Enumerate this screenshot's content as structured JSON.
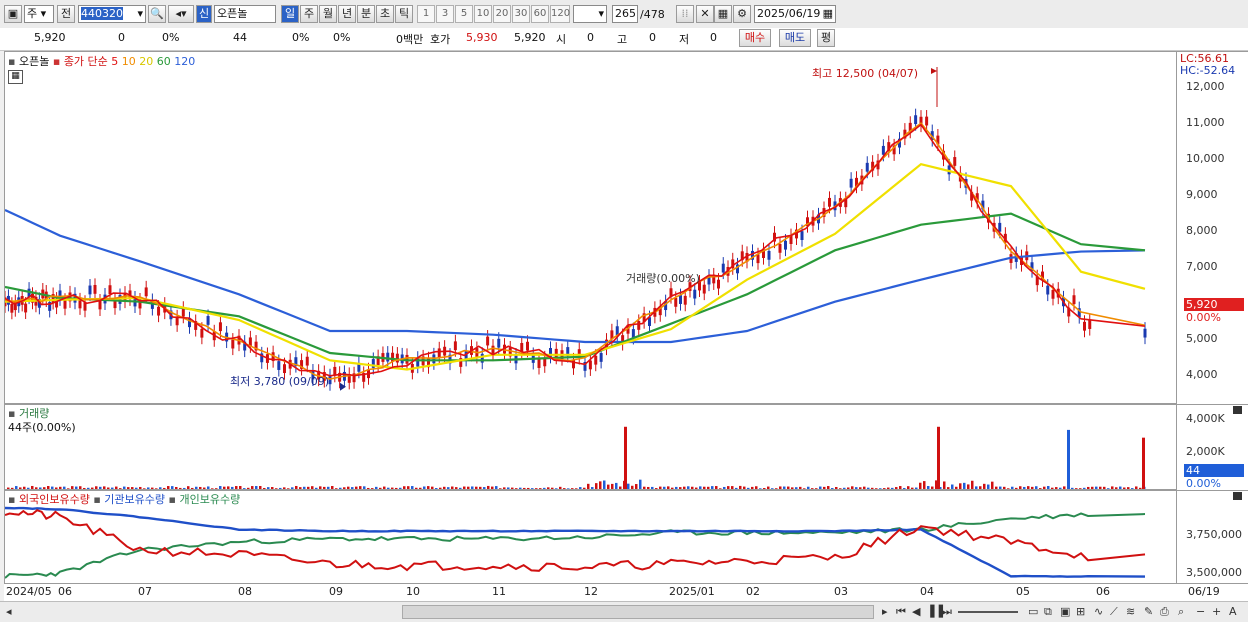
{
  "toolbar": {
    "market_label": "주",
    "prev_label": "전",
    "stock_code": "440320",
    "new_label": "신",
    "stock_name": "오픈놀",
    "periods": [
      "일",
      "주",
      "월",
      "년",
      "분",
      "초",
      "틱"
    ],
    "intervals": [
      "1",
      "3",
      "5",
      "10",
      "20",
      "30",
      "60",
      "120"
    ],
    "count_current": "265",
    "count_total": "/478",
    "date": "2025/06/19"
  },
  "quote": {
    "price": "5,920",
    "change": "0",
    "change_pct": "0%",
    "volume": "44",
    "v_pct1": "0%",
    "v_pct2": "0%",
    "amount": "0백만",
    "hoga_label": "호가",
    "ask": "5,930",
    "bid": "5,920",
    "open_label": "시",
    "open_val": "0",
    "high_label": "고",
    "high_val": "0",
    "low_label": "저",
    "low_val": "0",
    "buy_label": "매수",
    "sell_label": "매도",
    "avg_label": "평"
  },
  "price_pane": {
    "legend_name": "오픈놀",
    "legend_ma": "종가 단순",
    "ma_periods": [
      "5",
      "10",
      "20",
      "60",
      "120"
    ],
    "ma_colors": [
      "#e01010",
      "#f08c00",
      "#f0e000",
      "#2a9a3a",
      "#2c5fd8"
    ],
    "max_label": "최고 12,500 (04/07)",
    "min_label": "최저 3,780 (09/09)",
    "inline_label": "거래량(0.00%)",
    "lc": "LC:56.61",
    "hc": "HC:-52.64",
    "y_ticks": [
      "12,000",
      "11,000",
      "10,000",
      "9,000",
      "8,000",
      "7,000",
      "5,000",
      "4,000"
    ],
    "price_tag": "5,920",
    "pct_tag": "0.00%"
  },
  "volume_pane": {
    "title": "거래량",
    "sub": "44주(0.00%)",
    "y_ticks": [
      "4,000K",
      "2,000K"
    ],
    "tag": "44",
    "pct_tag": "0.00%"
  },
  "holdings_pane": {
    "s1": "외국인보유수량",
    "s2": "기관보유수량",
    "s3": "개인보유수량",
    "y_ticks": [
      "3,750,000",
      "3,500,000"
    ]
  },
  "x_axis": [
    "2024/05",
    "06",
    "07",
    "08",
    "09",
    "10",
    "11",
    "12",
    "2025/01",
    "02",
    "03",
    "04",
    "05",
    "06",
    "06/19"
  ],
  "chart_data": [
    {
      "type": "line",
      "title": "",
      "x": [
        "2024/05",
        "06",
        "07",
        "08",
        "09",
        "10",
        "11",
        "12",
        "2025/01",
        "02",
        "03",
        "04",
        "05",
        "06"
      ],
      "series": [
        {
          "name": "종가 단순 5",
          "values": [
            6100,
            6200,
            6200,
            5000,
            4000,
            4500,
            4800,
            4500,
            6200,
            7200,
            8700,
            11000,
            7500,
            5400
          ]
        },
        {
          "name": "60",
          "values": [
            6500,
            6200,
            6100,
            5700,
            4700,
            4500,
            4500,
            4600,
            5500,
            6300,
            7500,
            8200,
            8500,
            7500
          ]
        },
        {
          "name": "120",
          "values": [
            8600,
            7900,
            7200,
            6300,
            5300,
            5300,
            5200,
            5000,
            5000,
            5300,
            6100,
            6700,
            7300,
            7500
          ]
        }
      ],
      "max_point": {
        "date": "04/07",
        "value": 12500
      },
      "min_point": {
        "date": "09/09",
        "value": 3780
      },
      "ylim": [
        3500,
        12500
      ]
    },
    {
      "type": "bar",
      "title": "거래량",
      "categories": [
        "12",
        "04",
        "05",
        "06/19"
      ],
      "values": [
        4000000,
        4000000,
        3800000,
        3300000
      ],
      "ylim": [
        0,
        4500000
      ]
    },
    {
      "type": "line",
      "title": "",
      "series": [
        {
          "name": "외국인보유수량",
          "values": [
            3900000,
            3860000,
            3650000,
            3620000,
            3560000,
            3550000,
            3550000,
            3540000,
            3560000,
            3580000,
            3600000,
            3800000,
            3700000,
            3600000
          ]
        },
        {
          "name": "기관보유수량",
          "values": [
            3920000,
            3910000,
            3860000,
            3780000,
            3770000,
            3770000,
            3770000,
            3770000,
            3770000,
            3770000,
            3770000,
            3780000,
            3480000,
            3480000
          ]
        },
        {
          "name": "개인보유수량",
          "values": [
            3480000,
            3500000,
            3650000,
            3700000,
            3720000,
            3720000,
            3720000,
            3730000,
            3760000,
            3760000,
            3760000,
            3780000,
            3850000,
            3880000
          ]
        }
      ],
      "ylim": [
        3450000,
        3950000
      ]
    }
  ]
}
